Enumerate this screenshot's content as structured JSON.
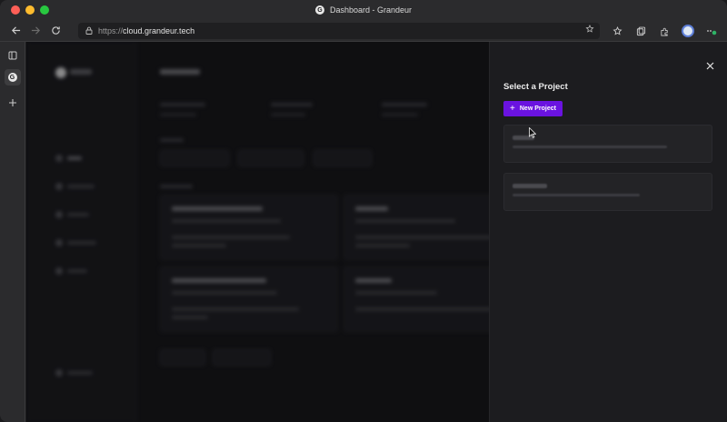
{
  "window": {
    "title": "Dashboard - Grandeur",
    "favicon_glyph": "G"
  },
  "toolbar": {
    "url_protocol": "https://",
    "url_host": "cloud.grandeur.tech",
    "back_icon": "arrow-left-icon",
    "forward_icon": "arrow-right-icon",
    "reload_icon": "reload-icon"
  },
  "drawer": {
    "title": "Select a Project",
    "new_project_label": "New Project",
    "close_icon": "close-icon"
  },
  "colors": {
    "accent": "#6a13e0",
    "background": "#1c1c1f"
  }
}
